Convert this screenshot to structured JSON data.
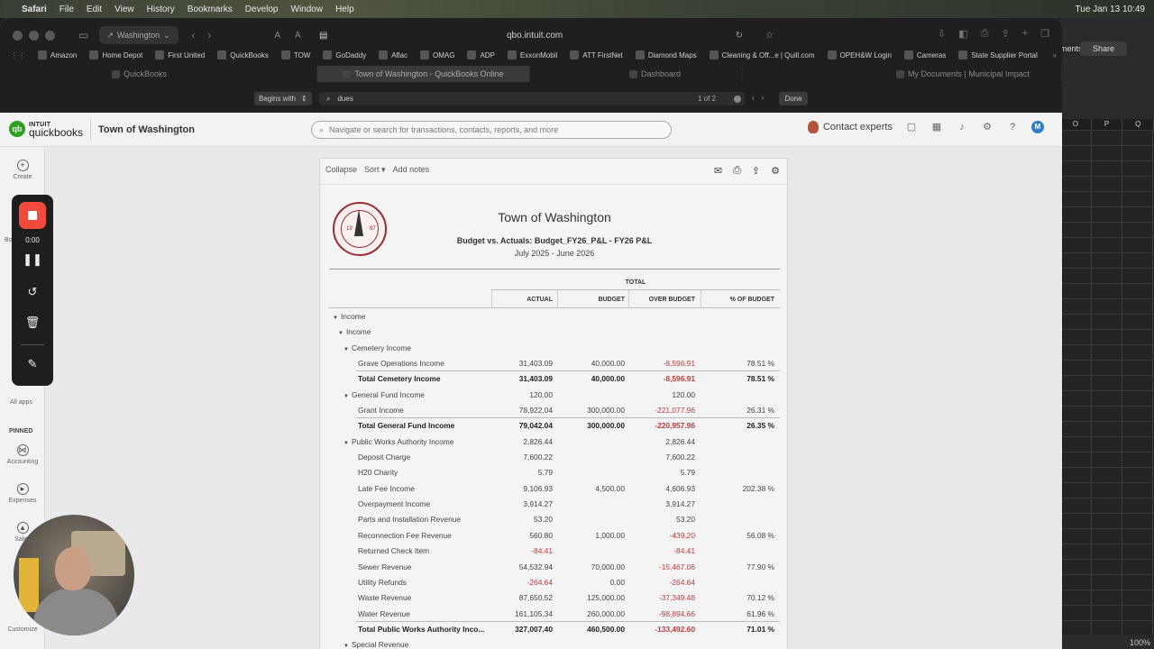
{
  "menubar": {
    "items": [
      "Safari",
      "File",
      "Edit",
      "View",
      "History",
      "Bookmarks",
      "Develop",
      "Window",
      "Help"
    ],
    "clock": "Tue Jan 13  10:49"
  },
  "browser": {
    "tab_group": "Washington",
    "url": "qbo.intuit.com",
    "bookmarks": [
      "Amazon",
      "Home Depot",
      "First United",
      "QuickBooks",
      "TOW",
      "GoDaddy",
      "Aflac",
      "OMAG",
      "ADP",
      "ExxonMobil",
      "ATT FirstNet",
      "Diamond Maps",
      "Cleaning & Off...e | Quill.com",
      "OPEH&W Login",
      "Cameras",
      "State Supplier Portal"
    ],
    "tabs": [
      "QuickBooks",
      "Town of Washington - QuickBooks Online",
      "Dashboard",
      "My Documents | Municipal Impact"
    ],
    "find": {
      "mode": "Begins with",
      "query": "dues",
      "count": "1 of 2",
      "done": "Done"
    }
  },
  "background_app": {
    "share": "Share",
    "ments": "ments",
    "cols": [
      "O",
      "P",
      "Q"
    ],
    "zoom": "100%"
  },
  "qb": {
    "intuit": "INTUIT",
    "brand": "quickbooks",
    "company": "Town of Washington",
    "search_placeholder": "Navigate or search for transactions, contacts, reports, and more",
    "contact_experts": "Contact experts",
    "avatar_initial": "M",
    "nav": {
      "create": "Create",
      "pinned": "PINNED",
      "accounting": "Accounting",
      "expenses": "Expenses",
      "sales": "Sales",
      "customize": "Customize",
      "partial_bo": "Bo",
      "partial_apps": "All apps"
    }
  },
  "recorder": {
    "time": "0:00"
  },
  "report": {
    "toolbar": {
      "collapse": "Collapse",
      "sort": "Sort",
      "add_notes": "Add notes"
    },
    "seal": {
      "left_year": "19",
      "right_year": "97"
    },
    "title": "Town of Washington",
    "subtitle": "Budget vs. Actuals: Budget_FY26_P&L - FY26 P&L",
    "range": "July 2025 - June 2026",
    "header_group": "TOTAL",
    "columns": [
      "ACTUAL",
      "BUDGET",
      "OVER BUDGET",
      "% OF BUDGET"
    ],
    "rows": [
      {
        "label": "Income",
        "indent": 0,
        "caret": true,
        "total": false,
        "actual": "",
        "budget": "",
        "over": "",
        "pct": "",
        "neg": false
      },
      {
        "label": "Income",
        "indent": 1,
        "caret": true,
        "total": false,
        "actual": "",
        "budget": "",
        "over": "",
        "pct": "",
        "neg": false
      },
      {
        "label": "Cemetery Income",
        "indent": 2,
        "caret": true,
        "total": false,
        "actual": "",
        "budget": "",
        "over": "",
        "pct": "",
        "neg": false
      },
      {
        "label": "Grave Operations Income",
        "indent": 3,
        "caret": false,
        "total": false,
        "actual": "31,403.09",
        "budget": "40,000.00",
        "over": "-8,596.91",
        "pct": "78.51 %",
        "neg": true
      },
      {
        "label": "Total Cemetery Income",
        "indent": 3,
        "caret": false,
        "total": true,
        "actual": "31,403.09",
        "budget": "40,000.00",
        "over": "-8,596.91",
        "pct": "78.51 %",
        "neg": true
      },
      {
        "label": "General Fund Income",
        "indent": 2,
        "caret": true,
        "total": false,
        "actual": "120.00",
        "budget": "",
        "over": "120.00",
        "pct": "",
        "neg": false
      },
      {
        "label": "Grant Income",
        "indent": 3,
        "caret": false,
        "total": false,
        "actual": "78,922.04",
        "budget": "300,000.00",
        "over": "-221,077.96",
        "pct": "26.31 %",
        "neg": true
      },
      {
        "label": "Total General Fund Income",
        "indent": 3,
        "caret": false,
        "total": true,
        "actual": "79,042.04",
        "budget": "300,000.00",
        "over": "-220,957.96",
        "pct": "26.35 %",
        "neg": true
      },
      {
        "label": "Public Works Authority Income",
        "indent": 2,
        "caret": true,
        "total": false,
        "actual": "2,826.44",
        "budget": "",
        "over": "2,826.44",
        "pct": "",
        "neg": false
      },
      {
        "label": "Deposit Charge",
        "indent": 3,
        "caret": false,
        "total": false,
        "actual": "7,600.22",
        "budget": "",
        "over": "7,600.22",
        "pct": "",
        "neg": false
      },
      {
        "label": "H20 Charity",
        "indent": 3,
        "caret": false,
        "total": false,
        "actual": "5.79",
        "budget": "",
        "over": "5.79",
        "pct": "",
        "neg": false
      },
      {
        "label": "Late Fee Income",
        "indent": 3,
        "caret": false,
        "total": false,
        "actual": "9,106.93",
        "budget": "4,500.00",
        "over": "4,606.93",
        "pct": "202.38 %",
        "neg": false
      },
      {
        "label": "Overpayment Income",
        "indent": 3,
        "caret": false,
        "total": false,
        "actual": "3,914.27",
        "budget": "",
        "over": "3,914.27",
        "pct": "",
        "neg": false
      },
      {
        "label": "Parts and Installation Revenue",
        "indent": 3,
        "caret": false,
        "total": false,
        "actual": "53.20",
        "budget": "",
        "over": "53.20",
        "pct": "",
        "neg": false
      },
      {
        "label": "Reconnection Fee Revenue",
        "indent": 3,
        "caret": false,
        "total": false,
        "actual": "560.80",
        "budget": "1,000.00",
        "over": "-439.20",
        "pct": "56.08 %",
        "neg": true
      },
      {
        "label": "Returned Check Item",
        "indent": 3,
        "caret": false,
        "total": false,
        "actual": "-84.41",
        "budget": "",
        "over": "-84.41",
        "pct": "",
        "neg": true,
        "negActual": true
      },
      {
        "label": "Sewer Revenue",
        "indent": 3,
        "caret": false,
        "total": false,
        "actual": "54,532.94",
        "budget": "70,000.00",
        "over": "-15,467.06",
        "pct": "77.90 %",
        "neg": true
      },
      {
        "label": "Utility Refunds",
        "indent": 3,
        "caret": false,
        "total": false,
        "actual": "-264.64",
        "budget": "0.00",
        "over": "-264.64",
        "pct": "",
        "neg": true,
        "negActual": true
      },
      {
        "label": "Waste Revenue",
        "indent": 3,
        "caret": false,
        "total": false,
        "actual": "87,650.52",
        "budget": "125,000.00",
        "over": "-37,349.48",
        "pct": "70.12 %",
        "neg": true
      },
      {
        "label": "Water Revenue",
        "indent": 3,
        "caret": false,
        "total": false,
        "actual": "161,105.34",
        "budget": "260,000.00",
        "over": "-98,894.66",
        "pct": "61.96 %",
        "neg": true
      },
      {
        "label": "Total Public Works Authority Inco...",
        "indent": 3,
        "caret": false,
        "total": true,
        "actual": "327,007.40",
        "budget": "460,500.00",
        "over": "-133,492.60",
        "pct": "71.01 %",
        "neg": true
      },
      {
        "label": "Special Revenue",
        "indent": 2,
        "caret": true,
        "total": false,
        "actual": "",
        "budget": "",
        "over": "",
        "pct": "",
        "neg": false
      }
    ]
  }
}
